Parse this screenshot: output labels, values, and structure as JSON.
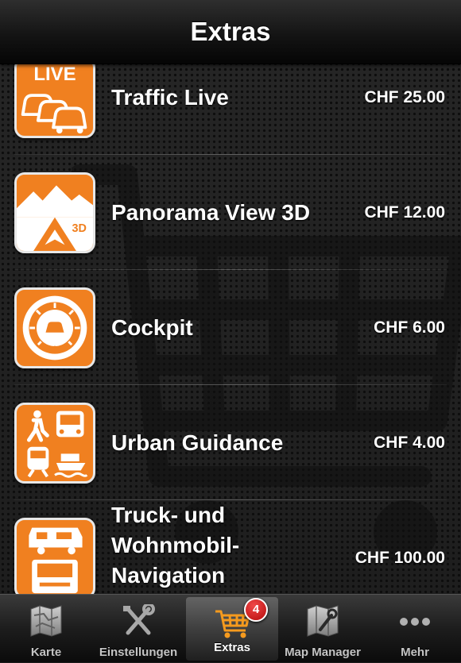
{
  "navbar": {
    "title": "Extras"
  },
  "extras": [
    {
      "name": "Traffic Live",
      "price": "CHF 25.00",
      "icon": "traffic-live-icon",
      "icon_text": "LIVE"
    },
    {
      "name": "Panorama View 3D",
      "price": "CHF 12.00",
      "icon": "panorama-3d-icon",
      "icon_text": "3D"
    },
    {
      "name": "Cockpit",
      "price": "CHF 6.00",
      "icon": "cockpit-speedometer-icon"
    },
    {
      "name": "Urban Guidance",
      "price": "CHF 4.00",
      "icon": "urban-transport-icon"
    },
    {
      "name_lines": [
        "Truck- und",
        "Wohnmobil-",
        "Navigation"
      ],
      "price": "CHF 100.00",
      "icon": "truck-camper-icon"
    }
  ],
  "tabbar": {
    "tabs": [
      {
        "label": "Karte",
        "icon": "map-icon",
        "active": false
      },
      {
        "label": "Einstellungen",
        "icon": "tools-icon",
        "active": false
      },
      {
        "label": "Extras",
        "icon": "shopping-cart-icon",
        "active": true,
        "badge": "4"
      },
      {
        "label": "Map Manager",
        "icon": "map-manager-icon",
        "active": false
      },
      {
        "label": "Mehr",
        "icon": "more-dots-icon",
        "active": false
      }
    ]
  },
  "colors": {
    "accent": "#f08020",
    "badge": "#d41f1f",
    "navbar": "#141414"
  }
}
